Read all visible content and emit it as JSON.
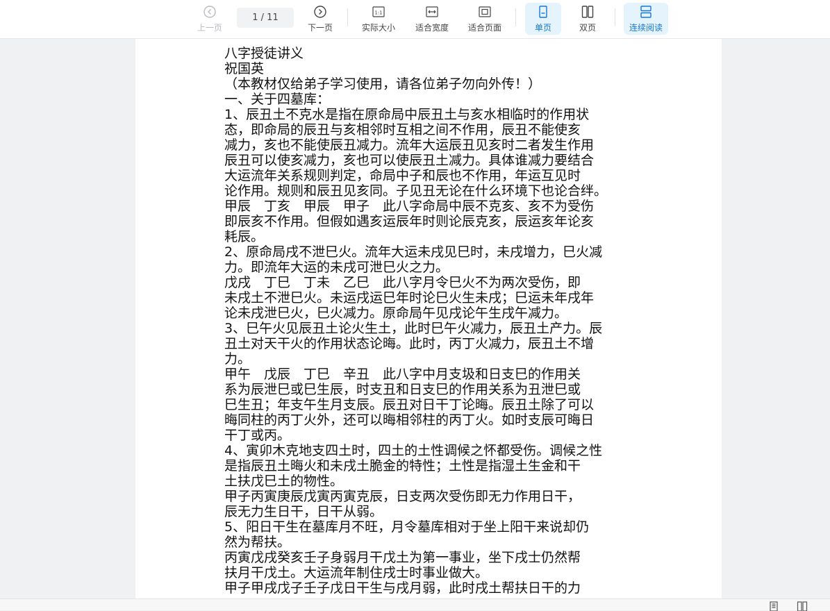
{
  "toolbar": {
    "prev": "上一页",
    "page_indicator": "1 / 11",
    "next": "下一页",
    "actual_size": "实际大小",
    "fit_width": "适合宽度",
    "fit_page": "适合页面",
    "single_page": "单页",
    "double_page": "双页",
    "continuous": "连续阅读",
    "actual_size_icon_text": "1:1"
  },
  "colors": {
    "accent": "#1677d2",
    "active_bg": "#e5f3fd"
  },
  "document": {
    "lines": [
      "八字授徒讲义",
      "祝国英",
      "（本教材仅给弟子学习使用，请各位弟子勿向外传！）",
      "一、关于四墓库：",
      "1、辰丑土不克水是指在原命局中辰丑土与亥水相临时的作用状",
      "态，即命局的辰丑与亥相邻时互相之间不作用，辰丑不能使亥",
      "减力，亥也不能使辰丑减力。流年大运辰丑见亥时二者发生作用",
      "辰丑可以使亥减力，亥也可以使辰丑土减力。具体谁减力要结合",
      "大运流年关系规则判定，命局中子和辰也不作用，年运互见时",
      "论作用。规则和辰丑见亥同。子见丑无论在什么环境下也论合绊。",
      "甲辰　丁亥　甲辰　甲子　此八字命局中辰不克亥、亥不为受伤",
      "即辰亥不作用。但假如遇亥运辰年时则论辰克亥，辰运亥年论亥",
      "耗辰。",
      "2、原命局戌不泄巳火。流年大运未戌见巳时，未戌增力，巳火减",
      "力。即流年大运的未戌可泄巳火之力。",
      "戊戌　丁巳　丁未　乙巳　此八字月令巳火不为两次受伤，即",
      "未戌土不泄巳火。未运戌运巳年时论巳火生未戌；巳运未年戌年",
      "论未戌泄巳火，巳火减力。原命局午见戌论午生戌午减力。",
      "3、巳午火见辰丑土论火生土，此时巳午火减力，辰丑土产力。辰",
      "丑土对天干火的作用状态论晦。此时，丙丁火减力，辰丑土不增",
      "力。",
      "甲午　戊辰　丁巳　辛丑　此八字中月支圾和日支巳的作用关",
      "系为辰泄巳或巳生辰，时支丑和日支巳的作用关系为丑泄巳或",
      "巳生丑；年支午生月支辰。辰丑对日干丁论晦。辰丑土除了可以",
      "晦同柱的丙丁火外，还可以晦相邻柱的丙丁火。如时支辰可晦日",
      "干丁或丙。",
      "4、寅卯木克地支四土时，四土的土性调候之怀都受伤。调候之性",
      "是指辰丑土晦火和未戌土脆金的特性；土性是指湿土生金和干",
      "土扶戊巳土的物性。",
      "甲子丙寅庚辰戊寅丙寅克辰，日支两次受伤即无力作用日干，",
      "辰无力生日干，日干从弱。",
      "5、阳日干生在墓库月不旺，月令墓库相对于坐上阳干来说却仍",
      "然为帮扶。",
      "丙寅戊戌癸亥壬子身弱月干戊土为第一事业，坐下戌士仍然帮",
      "扶月干戊土。大运流年制住戌士时事业做大。",
      "甲子甲戌戊子壬子戊日干生与戌月弱，此时戌土帮扶日干的力"
    ]
  }
}
